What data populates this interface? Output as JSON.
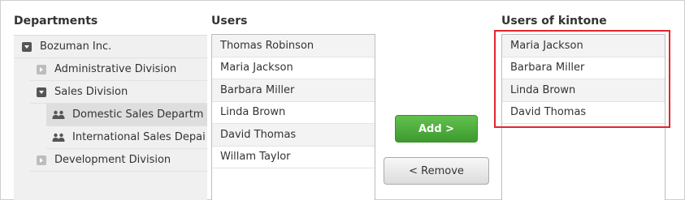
{
  "departments": {
    "title": "Departments",
    "items": [
      {
        "label": "Bozuman Inc.",
        "toggle": "expanded",
        "icon": "expand-toggle-icon"
      },
      {
        "label": "Administrative Division",
        "toggle": "collapsed",
        "icon": "collapse-toggle-icon"
      },
      {
        "label": "Sales Division",
        "toggle": "expanded",
        "icon": "expand-toggle-icon"
      },
      {
        "label": "Domestic Sales Departm",
        "icon": "group-icon",
        "selected": true
      },
      {
        "label": "International Sales Depai",
        "icon": "group-icon"
      },
      {
        "label": "Development Division",
        "toggle": "collapsed",
        "icon": "collapse-toggle-icon"
      }
    ]
  },
  "users": {
    "title": "Users",
    "items": [
      "Thomas Robinson",
      "Maria Jackson",
      "Barbara Miller",
      "Linda Brown",
      "David Thomas",
      "Willam Taylor"
    ]
  },
  "actions": {
    "add_label": "Add >",
    "remove_label": "< Remove"
  },
  "kintone_users": {
    "title": "Users of kintone",
    "items": [
      "Maria Jackson",
      "Barbara Miller",
      "Linda Brown",
      "David Thomas"
    ]
  },
  "colors": {
    "add_button": "#4caf3a",
    "highlight_border": "#e0262d",
    "selected_row": "#dedede"
  }
}
